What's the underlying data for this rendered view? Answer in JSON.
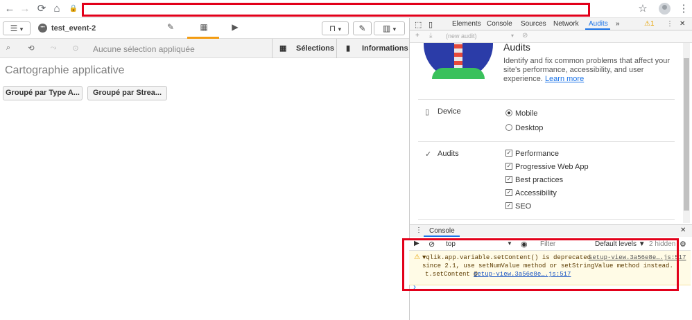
{
  "browser": {
    "back": "←",
    "forward": "→",
    "reload": "⟳",
    "home": "⌂",
    "lock": "🔒",
    "star": "☆",
    "menu": "⋮"
  },
  "qlik": {
    "menu_icon": "☰",
    "menu_caret": "▾",
    "app_icon": "•••",
    "app_name": "test_event-2",
    "tab_icons": [
      "✎",
      "▦",
      "▶"
    ],
    "bookmark_icon": "⊓",
    "bookmark_caret": "▾",
    "edit_icon": "✎",
    "view_icon": "▥",
    "view_caret": "▾",
    "selection_tools": [
      "⌕",
      "⟲",
      "⤳",
      "⊙"
    ],
    "no_selection": "Aucune sélection appliquée",
    "selections_icon": "▦",
    "selections_label": "Sélections",
    "info_icon": "▮",
    "info_label": "Informations",
    "sheet_title": "Cartographie applicative",
    "buttons": [
      "Groupé par Type A...",
      "Groupé par Strea..."
    ]
  },
  "devtools": {
    "tabs": [
      "Elements",
      "Console",
      "Sources",
      "Network",
      "Audits"
    ],
    "active_tab": "Audits",
    "more": "»",
    "warn_badge": "⚠1",
    "menu": "⋮",
    "close": "✕",
    "sub_plus": "+",
    "sub_down": "⤓",
    "new_audit": "(new audit)",
    "sub_caret": "▾",
    "sub_block": "⊘",
    "audits_title": "Audits",
    "audits_desc": "Identify and fix common problems that affect your site's performance, accessibility, and user experience.",
    "learn_more": "Learn more",
    "device_label": "Device",
    "device_icon": "▯",
    "device_options": [
      {
        "label": "Mobile",
        "checked": true
      },
      {
        "label": "Desktop",
        "checked": false
      }
    ],
    "audits_label": "Audits",
    "audits_icon": "✓",
    "audit_options": [
      "Performance",
      "Progressive Web App",
      "Best practices",
      "Accessibility",
      "SEO"
    ],
    "drawer_menu": "⋮",
    "drawer_tab": "Console",
    "drawer_close": "✕",
    "console": {
      "sidebar_icon": "▶",
      "clear_icon": "⊘",
      "context": "top",
      "context_caret": "▼",
      "eye_icon": "◉",
      "filter_placeholder": "Filter",
      "levels": "Default levels ▼",
      "hidden": "2 hidden",
      "settings": "⚙",
      "warn_icon": "⚠",
      "message": "▼qlik.app.variable.setContent() is deprecated",
      "source": "setup-view.3a56e8e….js:517",
      "message2": "since 2.1, use setNumValue method or setStringValue method instead.",
      "trace": "t.setContent @",
      "trace_link": "setup-view.3a56e8e….js:517",
      "prompt": "›"
    }
  }
}
